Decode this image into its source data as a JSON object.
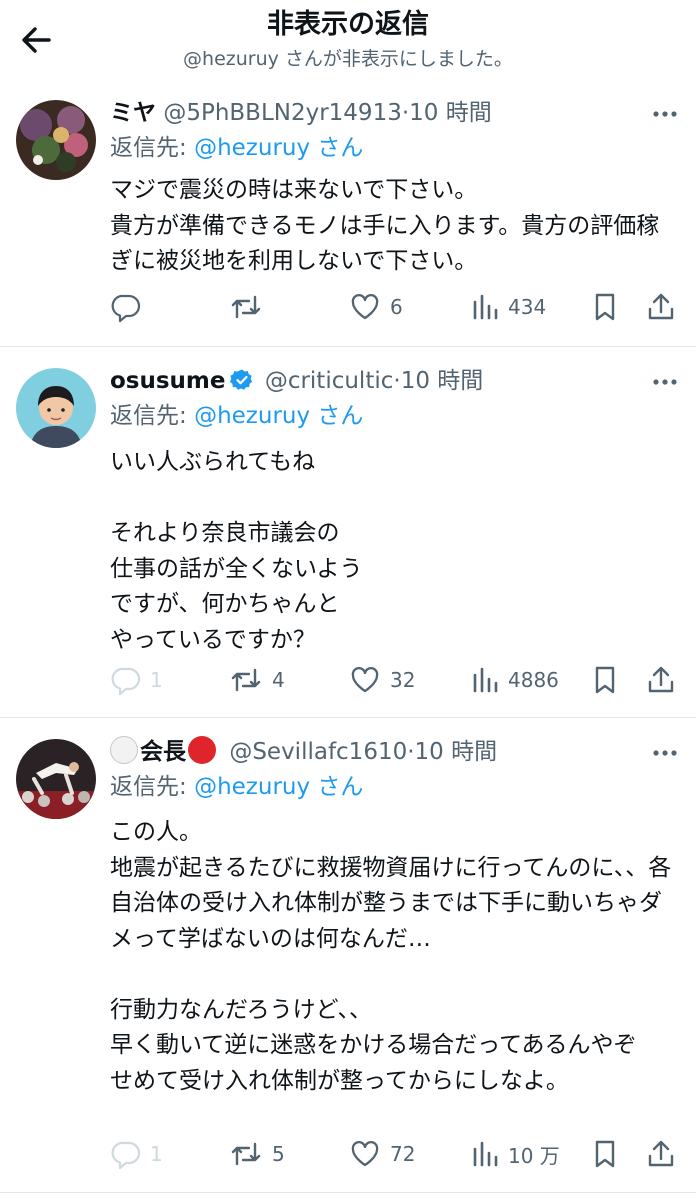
{
  "header": {
    "title": "非表示の返信",
    "subtitle": "@hezuruy さんが非表示にしました。"
  },
  "colors": {
    "accent": "#1d9bf0",
    "muted": "#536471",
    "text": "#0f1419",
    "divider": "#e1e6ea",
    "red_circle": "#e0242b"
  },
  "tweets": [
    {
      "display_name": "ミヤ",
      "handle": "@5PhBBLN2yr14913",
      "time": "10 時間",
      "reply_label": "返信先: ",
      "reply_mention": "@hezuruy さん",
      "text": "マジで震災の時は来ないで下さい。\n貴方が準備できるモノは手に入ります。貴方の評価稼ぎに被災地を利用しないで下さい。",
      "replies": "",
      "retweets": "",
      "likes": "6",
      "views": "434"
    },
    {
      "display_name": "osusume",
      "verified": true,
      "handle": "@criticultic",
      "time": "10 時間",
      "reply_label": "返信先: ",
      "reply_mention": "@hezuruy さん",
      "text": "いい人ぶられてもね\n\nそれより奈良市議会の\n仕事の話が全くないよう\nですが、何かちゃんと\nやっているですか？",
      "replies": "1",
      "retweets": "4",
      "likes": "32",
      "views": "4886"
    },
    {
      "display_name": "会長",
      "handle": "@Sevillafc1610",
      "time": "10 時間",
      "reply_label": "返信先: ",
      "reply_mention": "@hezuruy さん",
      "text": "この人。\n地震が起きるたびに救援物資届けに行ってんのに、、各自治体の受け入れ体制が整うまでは下手に動いちゃダメって学ばないのは何なんだ…\n\n行動力なんだろうけど、、\n早く動いて逆に迷惑をかける場合だってあるんやぞ\nせめて受け入れ体制が整ってからにしなよ。",
      "replies": "1",
      "retweets": "5",
      "likes": "72",
      "views": "10 万"
    }
  ],
  "icons": [
    "back-arrow-icon",
    "more-icon",
    "reply-icon",
    "retweet-icon",
    "like-icon",
    "views-icon",
    "bookmark-icon",
    "share-icon",
    "verified-icon"
  ]
}
